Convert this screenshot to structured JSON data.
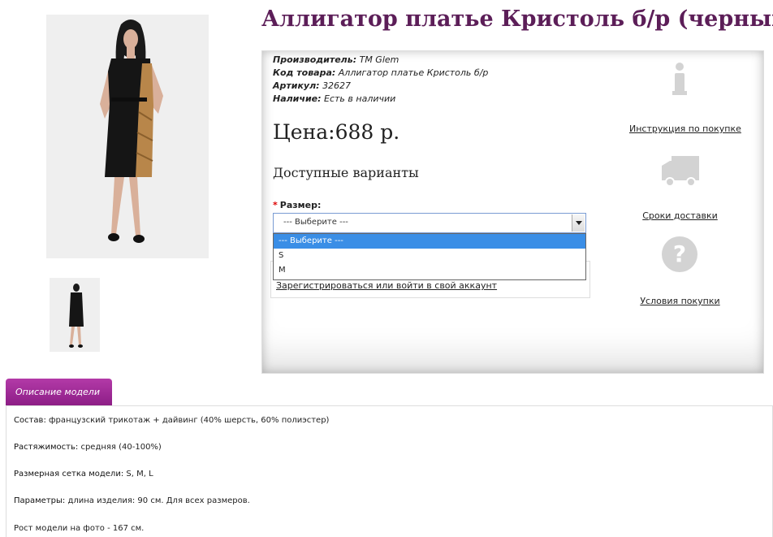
{
  "product": {
    "title": "Аллигатор платье Кристоль б/р (черный)",
    "main_image_alt": "dress-photo",
    "thumb_alt": "dress-thumbnail"
  },
  "meta": {
    "manufacturer_label": "Производитель:",
    "manufacturer_value": "TM Glem",
    "code_label": "Код товара:",
    "code_value": "Аллигатор платье Кристоль б/р",
    "sku_label": "Артикул:",
    "sku_value": "32627",
    "stock_label": "Наличие:",
    "stock_value": "Есть в наличии"
  },
  "price": "Цена:688 р.",
  "variants": {
    "title": "Доступные варианты",
    "size_label": "Размер:",
    "required_mark": "*",
    "selected": "--- Выберите ---",
    "options": [
      "--- Выберите ---",
      "S",
      "M"
    ]
  },
  "login_link": "Зарегистрироваться или войти в свой аккаунт",
  "services": {
    "instructions": "Инструкция по покупке",
    "delivery": "Сроки доставки",
    "terms": "Условия покупки"
  },
  "tab": {
    "label": "Описание модели"
  },
  "description": [
    {
      "label": "Состав:",
      "value": " французский трикотаж + дайвинг (40% шерсть, 60% полиэстер)"
    },
    {
      "label": "Растяжимость:",
      "value": " средняя (40-100%)"
    },
    {
      "label": "Размерная сетка модели:",
      "value": " S, M, L"
    },
    {
      "label": "Параметры:",
      "value": " длина изделия: 90 см. Для всех размеров."
    },
    {
      "label": "",
      "value": "Рост модели на фото - 167 см."
    }
  ],
  "colors": {
    "title": "#5c1e58",
    "tab": "#a22c99",
    "dropdown_highlight": "#3a8ee6"
  }
}
